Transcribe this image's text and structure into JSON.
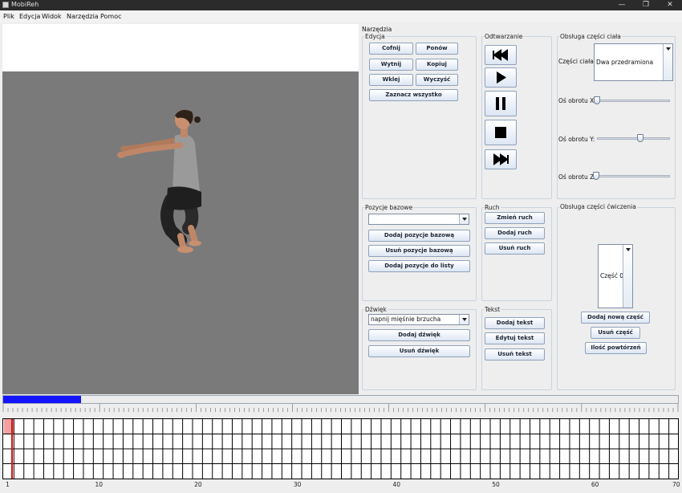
{
  "window": {
    "title": "MobiReh",
    "controls": [
      "—",
      "❐",
      "✕"
    ]
  },
  "menu": [
    "Plik",
    "Edycja",
    "Widok",
    "Narzędzia",
    "Pomoc"
  ],
  "tools": {
    "title": "Narzędzia",
    "edit": {
      "title": "Edycja",
      "undo": "Cofnij",
      "redo": "Ponów",
      "cut": "Wytnij",
      "copy": "Kopiuj",
      "paste": "Wklej",
      "clear": "Wyczyść",
      "select_all": "Zaznacz wszystko"
    },
    "playback": {
      "title": "Odtwarzanie",
      "buttons": [
        "skip-back-icon",
        "play-icon",
        "pause-icon",
        "stop-icon",
        "skip-forward-icon"
      ]
    },
    "body": {
      "title": "Obsługa części ciała",
      "part_label": "Części ciała:",
      "part_value": "Dwa przedramiona",
      "axis_x": "Oś obrotu X:",
      "axis_y": "Oś obrotu Y:",
      "axis_z": "Oś obrotu Z:",
      "slider_x": 0.0,
      "slider_y": 0.6,
      "slider_z": 0.0
    },
    "base": {
      "title": "Pozycje bazowe",
      "combo_value": "",
      "add": "Dodaj pozycje bazową",
      "remove": "Usuń pozycje bazową",
      "add_list": "Dodaj pozycje do listy"
    },
    "move": {
      "title": "Ruch",
      "change": "Zmień ruch",
      "add": "Dodaj ruch",
      "remove": "Usuń ruch"
    },
    "exercise": {
      "title": "Obsługa części ćwiczenia",
      "part": "Część 0",
      "add": "Dodaj nową część",
      "remove": "Usuń część",
      "repeats": "Ilość powtórzeń"
    },
    "sound": {
      "title": "Dźwięk",
      "combo_value": "napnij mięśnie brzucha",
      "add": "Dodaj dźwięk",
      "remove": "Usuń dźwięk"
    },
    "text": {
      "title": "Tekst",
      "add": "Dodaj tekst",
      "edit": "Edytuj tekst",
      "remove": "Usuń tekst"
    }
  },
  "progress": {
    "value": 0.115
  },
  "timeline": {
    "columns": 68,
    "rows": 4,
    "selected_column": 1,
    "axis_labels": [
      "1",
      "10",
      "20",
      "30",
      "40",
      "50",
      "60",
      "70"
    ],
    "colors": {
      "selected_fill": "#f5a0a0",
      "selected_border": "#e01010"
    }
  },
  "colors": {
    "progress": "#1414ff",
    "viewport": "#7a7a7a"
  }
}
